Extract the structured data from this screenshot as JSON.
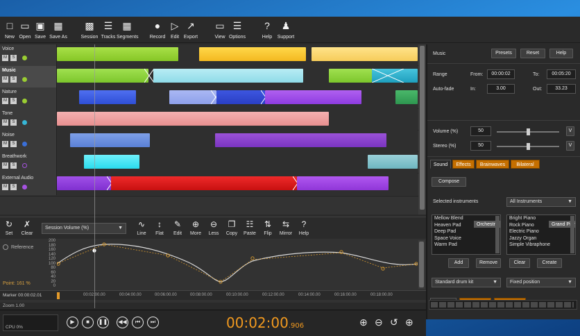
{
  "toolbar": {
    "items": [
      {
        "label": "New",
        "icon": "new-file-icon"
      },
      {
        "label": "Open",
        "icon": "folder-icon"
      },
      {
        "label": "Save",
        "icon": "save-icon"
      },
      {
        "label": "Save As",
        "icon": "save-as-icon"
      },
      {
        "label": "Session",
        "icon": "session-icon"
      },
      {
        "label": "Tracks",
        "icon": "tracks-icon"
      },
      {
        "label": "Segments",
        "icon": "segments-icon"
      },
      {
        "label": "Record",
        "icon": "microphone-icon"
      },
      {
        "label": "Edit",
        "icon": "edit-icon"
      },
      {
        "label": "Export",
        "icon": "export-icon"
      },
      {
        "label": "View",
        "icon": "monitor-icon"
      },
      {
        "label": "Options",
        "icon": "options-icon"
      },
      {
        "label": "Help",
        "icon": "help-icon"
      },
      {
        "label": "Support",
        "icon": "user-icon"
      }
    ]
  },
  "tracks": [
    {
      "name": "Voice",
      "mute": "M",
      "solo": "S",
      "color": "#9acd32"
    },
    {
      "name": "Music",
      "mute": "M",
      "solo": "S",
      "color": "#9acd32"
    },
    {
      "name": "Nature",
      "mute": "M",
      "solo": "S",
      "color": "#9acd32"
    },
    {
      "name": "Tone",
      "mute": "M",
      "solo": "S",
      "color": "#36b6d6"
    },
    {
      "name": "Noise",
      "mute": "M",
      "solo": "S",
      "color": "#3a6fd8"
    },
    {
      "name": "Breathwork",
      "mute": "M",
      "solo": "S",
      "color": "#a552e0"
    },
    {
      "name": "External Audio",
      "mute": "M",
      "solo": "S",
      "color": "#a552e0"
    }
  ],
  "envelope": {
    "buttons": [
      {
        "label": "Set",
        "icon": "refresh-icon"
      },
      {
        "label": "Clear",
        "icon": "clear-icon"
      },
      {
        "label": "Line",
        "icon": "line-icon"
      },
      {
        "label": "Flat",
        "icon": "flat-icon"
      },
      {
        "label": "Edit",
        "icon": "pencil-icon"
      },
      {
        "label": "More",
        "icon": "plus-circle-icon"
      },
      {
        "label": "Less",
        "icon": "minus-circle-icon"
      },
      {
        "label": "Copy",
        "icon": "copy-icon"
      },
      {
        "label": "Paste",
        "icon": "paste-icon"
      },
      {
        "label": "Flip",
        "icon": "flip-icon"
      },
      {
        "label": "Mirror",
        "icon": "mirror-icon"
      },
      {
        "label": "Help",
        "icon": "help-icon"
      }
    ],
    "selector": "Session Volume (%)",
    "reference": "Reference",
    "point": "Point: 161 %",
    "y_ticks": [
      "200",
      "180",
      "160",
      "140",
      "120",
      "100",
      "80",
      "60",
      "40",
      "20",
      "0"
    ],
    "marker_label": "Marker 00:00:02.01",
    "time_ticks": [
      "00:02:00.00",
      "00:04:00.00",
      "00:06:00.00",
      "00:08:00.00",
      "00:10:00.00",
      "00:12:00.00",
      "00:14:00.00",
      "00:16:00.00",
      "00:18:00.00"
    ],
    "zoom": "Zoom 1.00"
  },
  "transport": {
    "cpu": "CPU 0%",
    "time_main": "00:02:00",
    "time_ms": ".906"
  },
  "panel": {
    "title": "Music",
    "presets": "Presets",
    "reset": "Reset",
    "help": "Help",
    "range_label": "Range",
    "from_label": "From:",
    "from_value": "00:00:02",
    "to_label": "To:",
    "to_value": "00:05:20",
    "autofade_label": "Auto-fade",
    "in_label": "In:",
    "in_value": "3.00",
    "out_label": "Out:",
    "out_value": "33.23",
    "volume_label": "Volume (%)",
    "volume_value": "50",
    "volume_fraction": 0.5,
    "stereo_label": "Stereo (%)",
    "stereo_value": "50",
    "stereo_fraction": 0.5,
    "v_label": "V",
    "tabs": [
      "Sound",
      "Effects",
      "Brainwaves",
      "Bilateral"
    ],
    "compose": "Compose",
    "instruments_label": "Selected instruments",
    "instrument_filter": "All Instruments",
    "selected_instruments": [
      "Orchestral Harp",
      "Mellow Blend",
      "Heaven Pad",
      "Deep Pad",
      "Space Voice",
      "Warm Pad"
    ],
    "all_instruments": [
      "Grand Piano",
      "Bright Piano",
      "Rock Piano",
      "Electric Piano",
      "Jazzy Organ",
      "Simple Vibraphone"
    ],
    "add": "Add",
    "remove": "Remove",
    "clear": "Clear",
    "create": "Create",
    "drum_kit": "Standard drum kit",
    "position": "Fixed position",
    "bottom_tabs": [
      "Orchestra",
      "Composition",
      "Performance"
    ]
  }
}
